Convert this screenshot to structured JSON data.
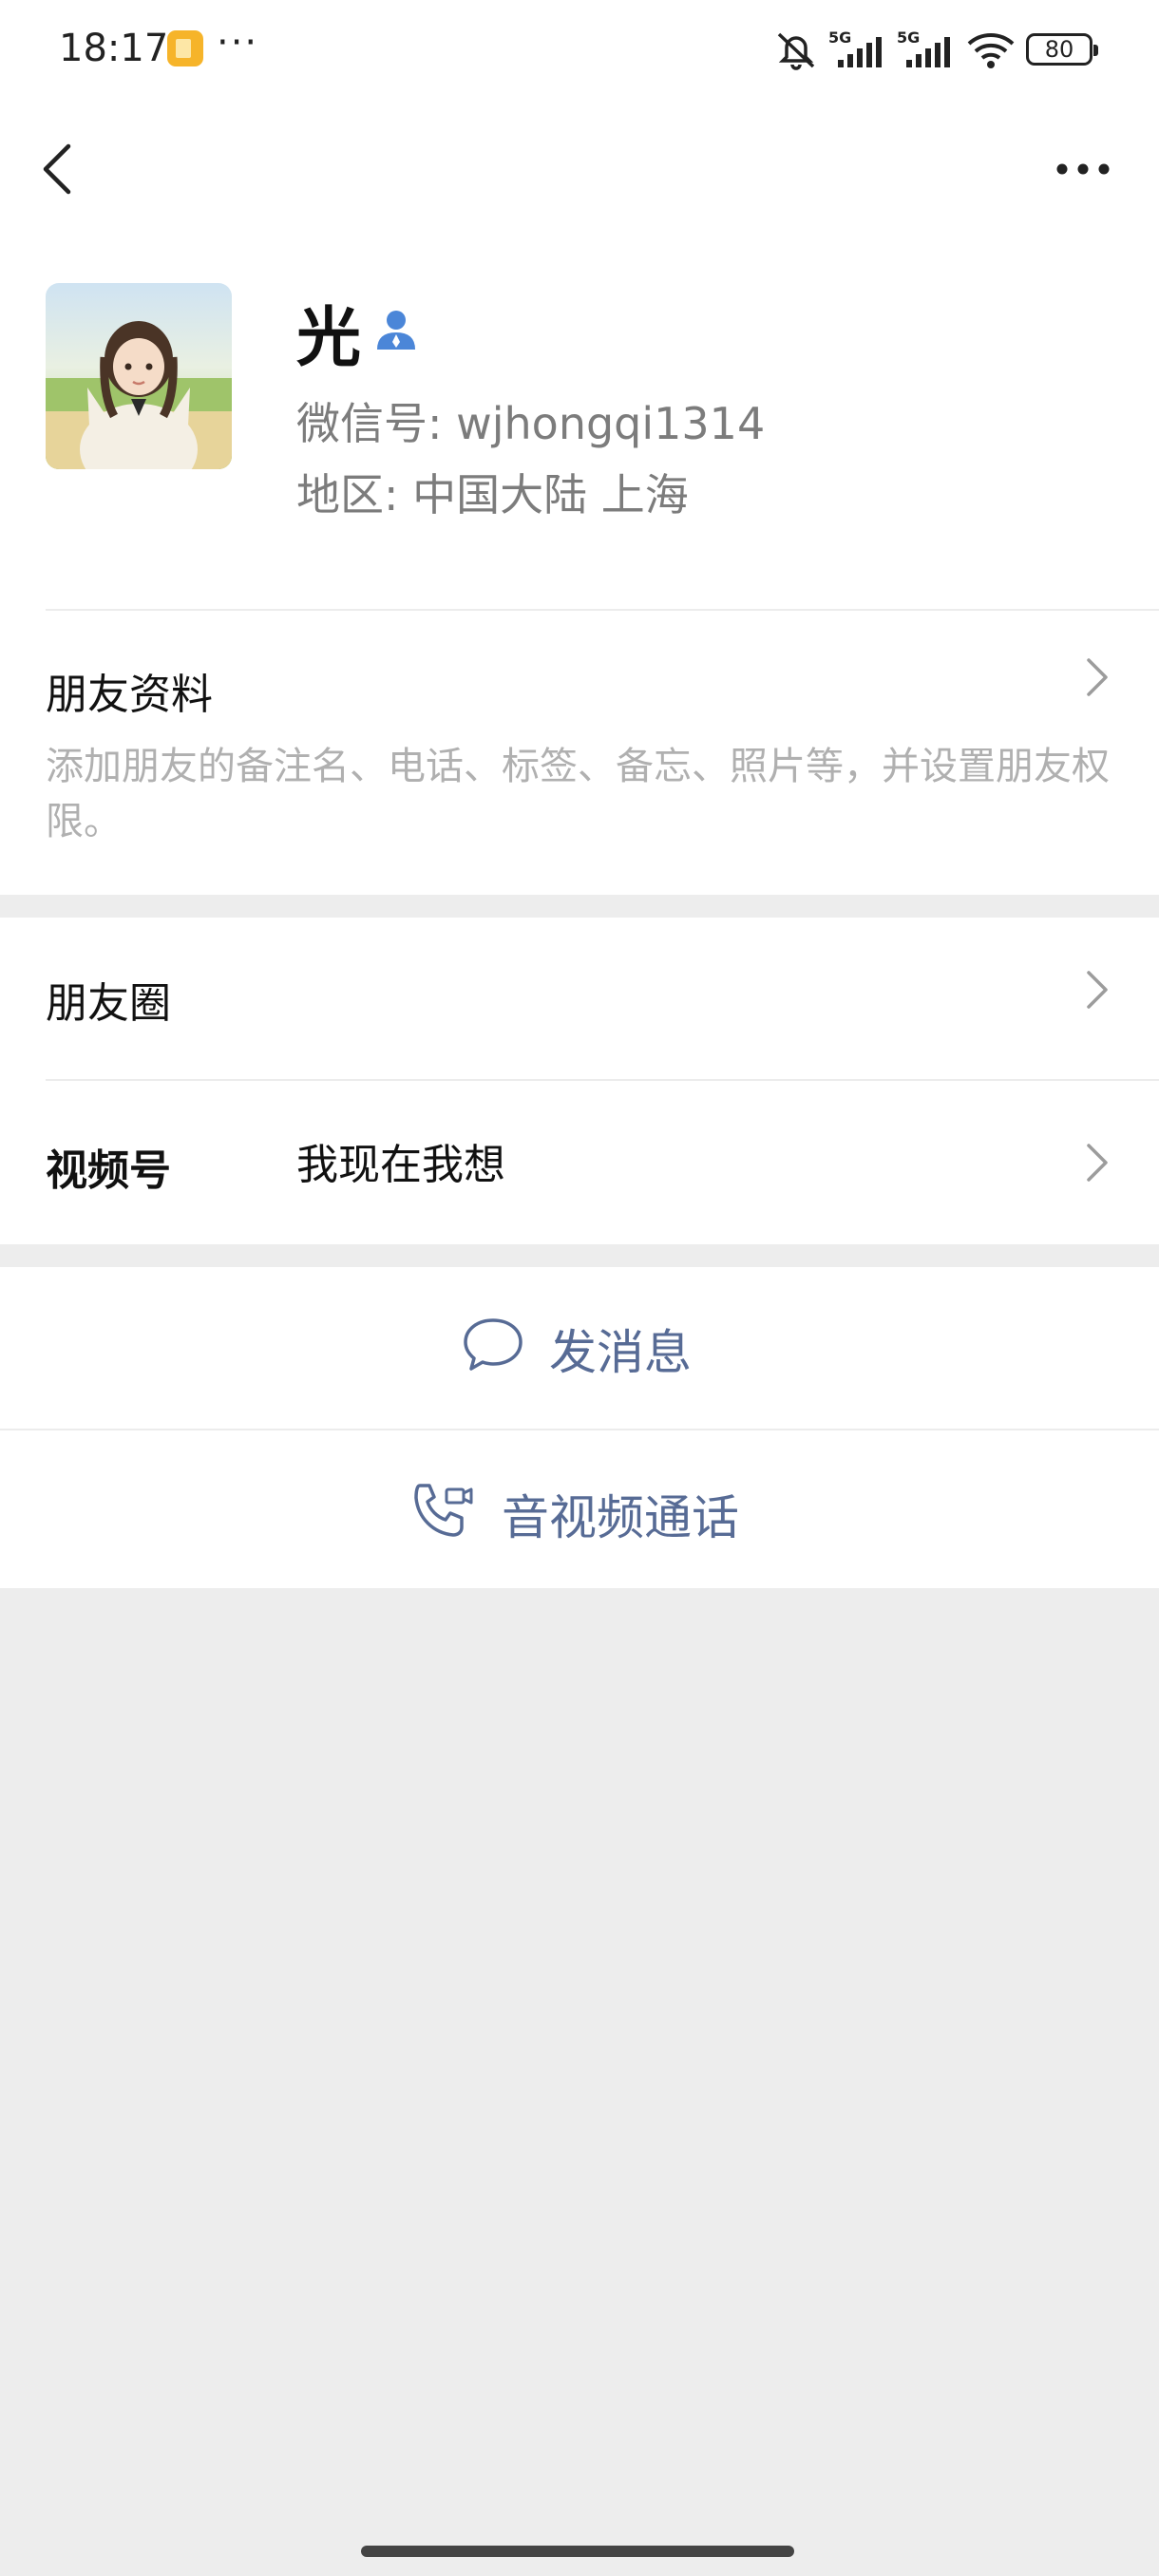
{
  "status_bar": {
    "time": "18:17",
    "icons": [
      "app-notification-icon",
      "more-notifications-icon",
      "mute-icon",
      "signal-5g-icon",
      "signal-5g-icon",
      "wifi-icon",
      "battery-icon"
    ],
    "signal_label_1": "5G",
    "signal_label_2": "5G",
    "battery": "80"
  },
  "nav": {
    "back_icon": "chevron-left-icon",
    "more_icon": "more-dots-icon"
  },
  "profile": {
    "name": "光",
    "gender_icon": "person-icon",
    "wechat_id": "微信号: wjhongqi1314",
    "region": "地区: 中国大陆  上海"
  },
  "cells": {
    "friend_info": {
      "title": "朋友资料",
      "desc": "添加朋友的备注名、电话、标签、备忘、照片等，并设置朋友权限。"
    },
    "moments": {
      "title": "朋友圈"
    },
    "channels": {
      "title": "视频号",
      "value": "我现在我想"
    }
  },
  "actions": {
    "message": {
      "label": "发消息",
      "icon": "chat-bubble-icon"
    },
    "call": {
      "label": "音视频通话",
      "icon": "phone-video-icon"
    }
  },
  "colors": {
    "link": "#576b95",
    "background": "#ededed",
    "accent_blue": "#4b86d8"
  }
}
